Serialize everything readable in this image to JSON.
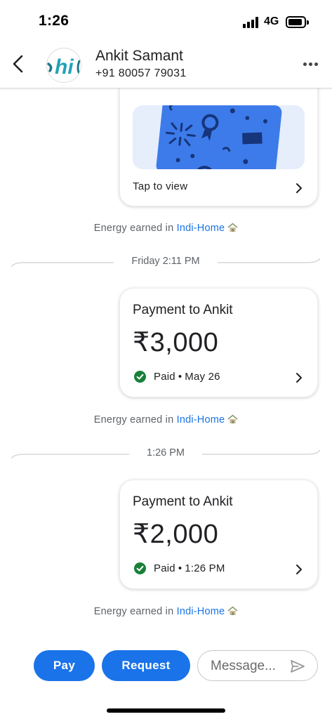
{
  "status_bar": {
    "time": "1:26",
    "network": "4G"
  },
  "header": {
    "contact_name": "Ankit Samant",
    "contact_phone": "+91 80057 79031",
    "avatar_text": "hi"
  },
  "reward_card": {
    "tap_label": "Tap to view"
  },
  "energy": {
    "prefix": "Energy earned in ",
    "link": "Indi-Home"
  },
  "dividers": [
    {
      "label": "Friday 2:11 PM"
    },
    {
      "label": "1:26 PM"
    }
  ],
  "payments": [
    {
      "title": "Payment to Ankit",
      "amount": "₹3,000",
      "status": "Paid",
      "date": "May 26"
    },
    {
      "title": "Payment to Ankit",
      "amount": "₹2,000",
      "status": "Paid",
      "date": "1:26 PM"
    }
  ],
  "bottom_bar": {
    "pay_label": "Pay",
    "request_label": "Request",
    "message_placeholder": "Message..."
  },
  "colors": {
    "accent": "#1a73e8",
    "paid_green": "#188038",
    "link": "#1a73e8"
  }
}
